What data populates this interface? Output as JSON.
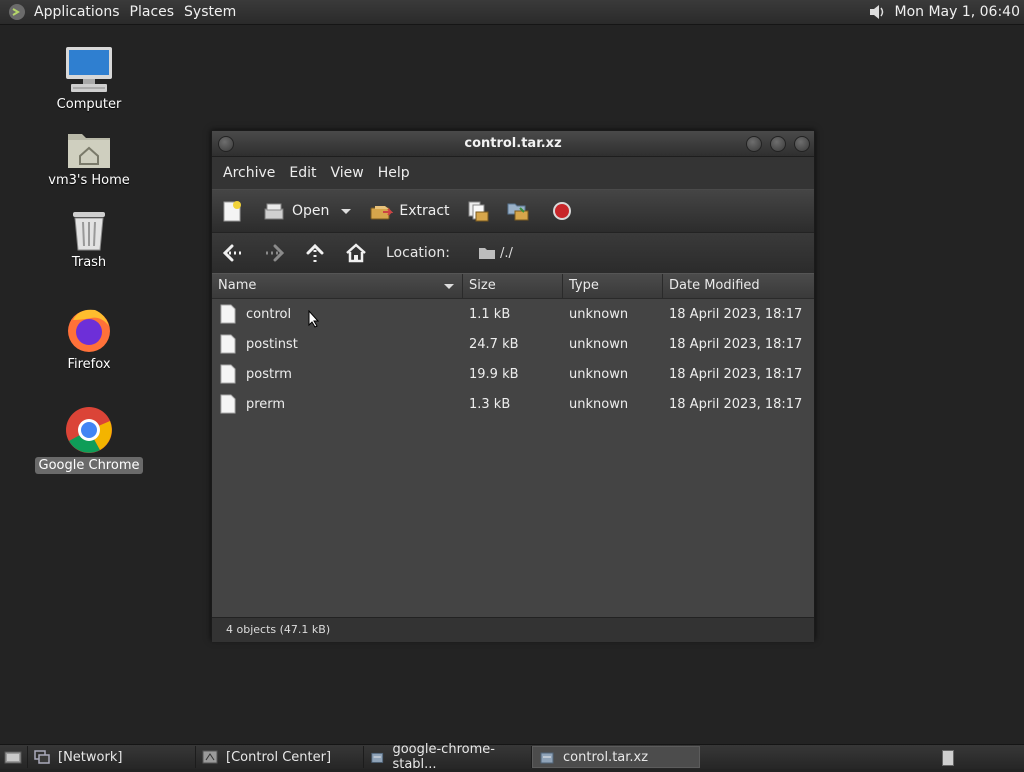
{
  "top_panel": {
    "menus": [
      "Applications",
      "Places",
      "System"
    ],
    "clock": "Mon May  1, 06:40",
    "volume_icon": "speaker-icon"
  },
  "desktop": {
    "icons": [
      {
        "label": "Computer",
        "icon": "computer-icon"
      },
      {
        "label": "vm3's Home",
        "icon": "home-folder-icon"
      },
      {
        "label": "Trash",
        "icon": "trash-icon"
      },
      {
        "label": "Firefox",
        "icon": "firefox-icon"
      },
      {
        "label": "Google Chrome",
        "icon": "chrome-icon"
      }
    ]
  },
  "window": {
    "title": "control.tar.xz",
    "menubar": [
      "Archive",
      "Edit",
      "View",
      "Help"
    ],
    "toolbar": {
      "open_label": "Open",
      "extract_label": "Extract"
    },
    "location": {
      "label": "Location:",
      "path": "/./"
    },
    "columns": [
      "Name",
      "Size",
      "Type",
      "Date Modified"
    ],
    "files": [
      {
        "name": "control",
        "size": "1.1 kB",
        "type": "unknown",
        "date": "18 April 2023, 18:17"
      },
      {
        "name": "postinst",
        "size": "24.7 kB",
        "type": "unknown",
        "date": "18 April 2023, 18:17"
      },
      {
        "name": "postrm",
        "size": "19.9 kB",
        "type": "unknown",
        "date": "18 April 2023, 18:17"
      },
      {
        "name": "prerm",
        "size": "1.3 kB",
        "type": "unknown",
        "date": "18 April 2023, 18:17"
      }
    ],
    "status": "4 objects (47.1 kB)"
  },
  "taskbar": {
    "tasks": [
      {
        "label": "[Network]",
        "active": false
      },
      {
        "label": "[Control Center]",
        "active": false
      },
      {
        "label": "google-chrome-stabl...",
        "active": false
      },
      {
        "label": "control.tar.xz",
        "active": true
      }
    ]
  },
  "colors": {
    "desktop_bg": "#232323",
    "window_bg": "#444444",
    "stop_red": "#c8262a"
  }
}
